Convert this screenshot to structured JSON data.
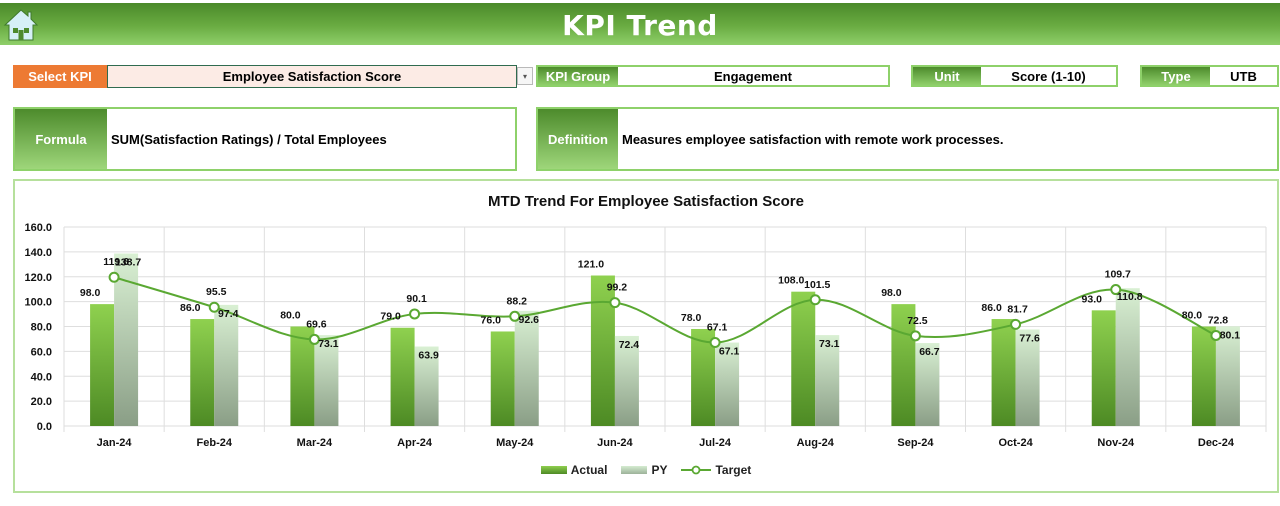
{
  "header": {
    "title": "KPI Trend",
    "home_icon": "home-icon"
  },
  "filters": {
    "select_kpi_label": "Select KPI",
    "select_kpi_value": "Employee Satisfaction Score",
    "dropdown_icon": "▾",
    "kpi_group_label": "KPI Group",
    "kpi_group_value": "Engagement",
    "unit_label": "Unit",
    "unit_value": "Score (1-10)",
    "type_label": "Type",
    "type_value": "UTB"
  },
  "info": {
    "formula_label": "Formula",
    "formula_value": "SUM(Satisfaction Ratings) / Total Employees",
    "definition_label": "Definition",
    "definition_value": "Measures employee satisfaction with remote work processes."
  },
  "colors": {
    "accent_orange": "#ed7a33",
    "accent_green": "#6aac42",
    "target_line": "#5aa832"
  },
  "chart_data": {
    "type": "bar",
    "title": "MTD Trend For Employee Satisfaction Score",
    "xlabel": "",
    "ylabel": "",
    "ylim": [
      0,
      160
    ],
    "yticks": [
      "0.0",
      "20.0",
      "40.0",
      "60.0",
      "80.0",
      "100.0",
      "120.0",
      "140.0",
      "160.0"
    ],
    "grid": true,
    "legend_position": "bottom",
    "categories": [
      "Jan-24",
      "Feb-24",
      "Mar-24",
      "Apr-24",
      "May-24",
      "Jun-24",
      "Jul-24",
      "Aug-24",
      "Sep-24",
      "Oct-24",
      "Nov-24",
      "Dec-24"
    ],
    "series": [
      {
        "name": "Actual",
        "type": "bar",
        "values": [
          98.0,
          86.0,
          80.0,
          79.0,
          76.0,
          121.0,
          78.0,
          108.0,
          98.0,
          86.0,
          93.0,
          80.0
        ]
      },
      {
        "name": "PY",
        "type": "bar",
        "values": [
          138.7,
          97.4,
          73.1,
          63.9,
          92.6,
          72.4,
          67.1,
          73.1,
          66.7,
          77.6,
          110.8,
          80.1
        ]
      },
      {
        "name": "Target",
        "type": "line",
        "values": [
          119.6,
          95.5,
          69.6,
          90.1,
          88.2,
          99.2,
          67.1,
          101.5,
          72.5,
          81.7,
          109.7,
          72.8
        ]
      }
    ]
  }
}
